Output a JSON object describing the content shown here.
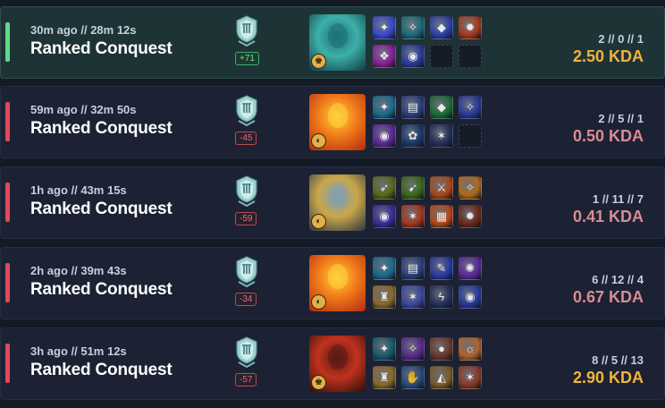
{
  "colors": {
    "win": "#5fd98a",
    "loss": "#e0485b",
    "kda_good": "#f0b43c",
    "kda_bad": "#d98c93"
  },
  "matches": [
    {
      "result": "win",
      "time": "30m ago // 28m 12s",
      "mode": "Ranked Conquest",
      "rank_icon": "conquest-rank-shield-icon",
      "delta": "+71",
      "god": {
        "icon": "god-portrait-jackal-icon",
        "colors": [
          "#1e6f78",
          "#3db0a8",
          "#0f3a44"
        ]
      },
      "role_icon": "guardian-role-icon",
      "role_glyph": "♚",
      "items": [
        {
          "icon": "relic-item-icon",
          "color": "#3b49c9",
          "glyph": "✦"
        },
        {
          "icon": "mace-item-icon",
          "color": "#1d6a7a",
          "glyph": "✧"
        },
        {
          "icon": "shield-item-icon",
          "color": "#2c3fa4",
          "glyph": "◆"
        },
        {
          "icon": "ember-item-icon",
          "color": "#a63a1e",
          "glyph": "✹"
        },
        {
          "icon": "portal-item-icon",
          "color": "#8a1f9a",
          "glyph": "❖"
        },
        {
          "icon": "eye-item-icon",
          "color": "#2a3a9a",
          "glyph": "◉"
        },
        {
          "icon": "empty-slot-icon",
          "color": "",
          "glyph": ""
        },
        {
          "icon": "empty-slot-icon",
          "color": "",
          "glyph": ""
        }
      ],
      "kills": "2 // 0 // 1",
      "kda": "2.50 KDA",
      "kda_tier": "good"
    },
    {
      "result": "loss",
      "time": "59m ago // 32m 50s",
      "mode": "Ranked Conquest",
      "rank_icon": "conquest-rank-shield-icon",
      "delta": "-45",
      "god": {
        "icon": "god-portrait-sun-icon",
        "colors": [
          "#ffd23a",
          "#f07a1a",
          "#b22a10"
        ]
      },
      "role_icon": "mage-role-icon",
      "role_glyph": "◐",
      "items": [
        {
          "icon": "staff-item-icon",
          "color": "#1c6b8c",
          "glyph": "✦"
        },
        {
          "icon": "book-item-icon",
          "color": "#2b3f7a",
          "glyph": "▤"
        },
        {
          "icon": "gem-item-icon",
          "color": "#1f6b3a",
          "glyph": "◆"
        },
        {
          "icon": "trident-item-icon",
          "color": "#2a3a9a",
          "glyph": "✧"
        },
        {
          "icon": "orb-item-icon",
          "color": "#5a2a9a",
          "glyph": "◉"
        },
        {
          "icon": "flower-item-icon",
          "color": "#1a3a6a",
          "glyph": "✿"
        },
        {
          "icon": "wand-item-icon",
          "color": "#24305a",
          "glyph": "✶"
        },
        {
          "icon": "empty-slot-icon",
          "color": "",
          "glyph": ""
        }
      ],
      "kills": "2 // 5 // 1",
      "kda": "0.50 KDA",
      "kda_tier": "bad"
    },
    {
      "result": "loss",
      "time": "1h ago // 43m 15s",
      "mode": "Ranked Conquest",
      "rank_icon": "conquest-rank-shield-icon",
      "delta": "-59",
      "god": {
        "icon": "god-portrait-warrior-icon",
        "colors": [
          "#7fa0b2",
          "#c9a64a",
          "#2c3640"
        ]
      },
      "role_icon": "mage-role-icon",
      "role_glyph": "◐",
      "items": [
        {
          "icon": "bow-item-icon",
          "color": "#5a6a1a",
          "glyph": "➶"
        },
        {
          "icon": "arrow-item-icon",
          "color": "#3a6a1a",
          "glyph": "➹"
        },
        {
          "icon": "sword-item-icon",
          "color": "#a64a1a",
          "glyph": "⚔"
        },
        {
          "icon": "blade-item-icon",
          "color": "#b06a1a",
          "glyph": "✧"
        },
        {
          "icon": "orb-item-icon",
          "color": "#3a2a9a",
          "glyph": "◉"
        },
        {
          "icon": "crossbow-item-icon",
          "color": "#a6381e",
          "glyph": "✶"
        },
        {
          "icon": "bracer-item-icon",
          "color": "#b04a1a",
          "glyph": "▦"
        },
        {
          "icon": "spear-item-icon",
          "color": "#6a2a1a",
          "glyph": "✹"
        }
      ],
      "kills": "1 // 11 // 7",
      "kda": "0.41 KDA",
      "kda_tier": "bad"
    },
    {
      "result": "loss",
      "time": "2h ago // 39m 43s",
      "mode": "Ranked Conquest",
      "rank_icon": "conquest-rank-shield-icon",
      "delta": "-34",
      "god": {
        "icon": "god-portrait-sun-icon",
        "colors": [
          "#ffd23a",
          "#f07a1a",
          "#b22a10"
        ]
      },
      "role_icon": "mage-role-icon",
      "role_glyph": "◐",
      "items": [
        {
          "icon": "relic-item-icon",
          "color": "#1c6b8c",
          "glyph": "✦"
        },
        {
          "icon": "book-item-icon",
          "color": "#2b3f7a",
          "glyph": "▤"
        },
        {
          "icon": "feather-item-icon",
          "color": "#2a3aa0",
          "glyph": "✎"
        },
        {
          "icon": "staff-item-icon",
          "color": "#5a2a9a",
          "glyph": "✺"
        },
        {
          "icon": "chalice-item-icon",
          "color": "#8a6a2a",
          "glyph": "♜"
        },
        {
          "icon": "wand-item-icon",
          "color": "#3a4aa0",
          "glyph": "✶"
        },
        {
          "icon": "lightning-item-icon",
          "color": "#24305a",
          "glyph": "ϟ"
        },
        {
          "icon": "eye-item-icon",
          "color": "#2a3a9a",
          "glyph": "◉"
        }
      ],
      "kills": "6 // 12 // 4",
      "kda": "0.67 KDA",
      "kda_tier": "bad"
    },
    {
      "result": "loss",
      "time": "3h ago // 51m 12s",
      "mode": "Ranked Conquest",
      "rank_icon": "conquest-rank-shield-icon",
      "delta": "-57",
      "god": {
        "icon": "god-portrait-hero-icon",
        "colors": [
          "#5a1a14",
          "#c0321e",
          "#2a0f0c"
        ]
      },
      "role_icon": "guardian-role-icon",
      "role_glyph": "♚",
      "items": [
        {
          "icon": "orb-item-icon",
          "color": "#1a5a6a",
          "glyph": "✦"
        },
        {
          "icon": "star-item-icon",
          "color": "#5a2a8a",
          "glyph": "✧"
        },
        {
          "icon": "sphere-item-icon",
          "color": "#6a3a2a",
          "glyph": "●"
        },
        {
          "icon": "mask-item-icon",
          "color": "#b0642a",
          "glyph": "☼"
        },
        {
          "icon": "chalice-item-icon",
          "color": "#8a6a2a",
          "glyph": "♜"
        },
        {
          "icon": "hands-item-icon",
          "color": "#2a4a7a",
          "glyph": "✋"
        },
        {
          "icon": "cloak-item-icon",
          "color": "#7a5a2a",
          "glyph": "◭"
        },
        {
          "icon": "totem-item-icon",
          "color": "#8a3a2a",
          "glyph": "✶"
        }
      ],
      "kills": "8 // 5 // 13",
      "kda": "2.90 KDA",
      "kda_tier": "good"
    }
  ]
}
